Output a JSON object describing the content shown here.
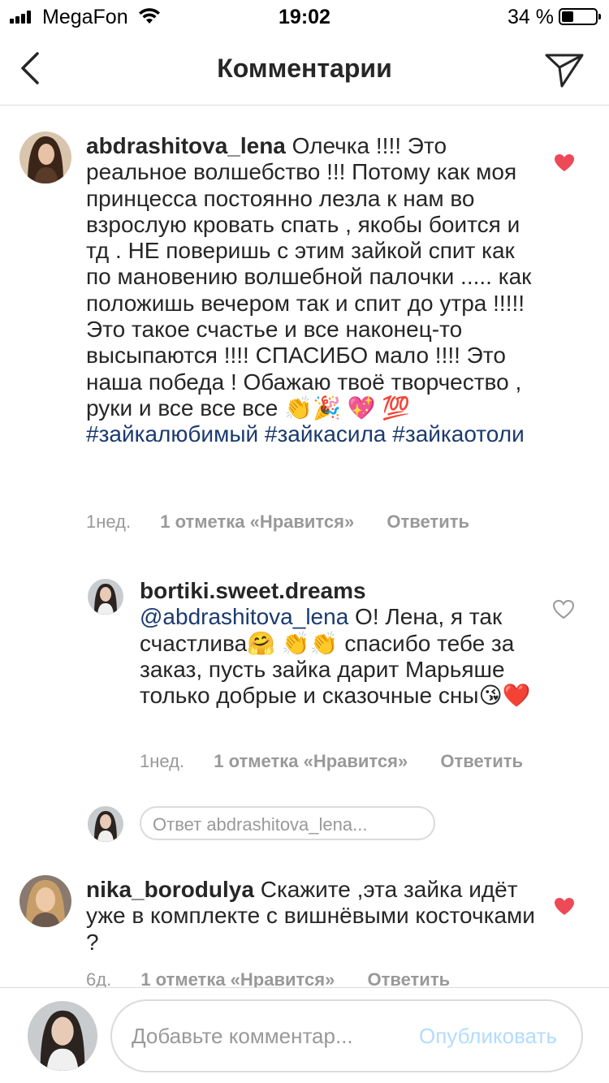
{
  "status_bar": {
    "carrier": "MegaFon",
    "time": "19:02",
    "battery": "34 %",
    "battery_level": 0.34
  },
  "header": {
    "title": "Комментарии"
  },
  "comments": [
    {
      "username": "abdrashitova_lena",
      "text": "Олечка !!!! Это реальное волшебство !!! Потому как моя принцесса постоянно лезла к нам во взрослую кровать спать , якобы боится и тд . НЕ поверишь с этим зайкой спит как по мановению волшебной палочки ..... как положишь вечером так и спит до утра !!!!! Это такое счастье и все наконец-то высыпаются !!!! СПАСИБО мало !!!! Это наша победа ! Обажаю твоё творчество , руки и все все все 👏🎉",
      "emoji_line": "💖 💯",
      "hashtags": [
        "#зайкалюбимый",
        "#зайкасила",
        "#зайкаотоли"
      ],
      "time": "1нед.",
      "likes": "1 отметка «Нравится»",
      "reply": "Ответить",
      "liked": true
    },
    {
      "username": "bortiki.sweet.dreams",
      "mention": "@abdrashitova_lena",
      "text": "О! Лена, я так счастлива🤗 👏👏 спасибо тебе за заказ,  пусть зайка дарит Марьяше только добрые и сказочные сны😘❤️",
      "time": "1нед.",
      "likes": "1 отметка «Нравится»",
      "reply": "Ответить",
      "liked": false
    },
    {
      "username": "nika_borodulya",
      "text": "Скажите ,эта зайка идёт уже в комплекте с вишнёвыми косточками ?",
      "time": "6д.",
      "likes": "1 отметка «Нравится»",
      "reply": "Ответить",
      "liked": true
    }
  ],
  "reply_input": {
    "placeholder": "Ответ abdrashitova_lena..."
  },
  "composer": {
    "placeholder": "Добавьте комментар...",
    "post_label": "Опубликовать"
  },
  "colors": {
    "heart_liked": "#ed4956",
    "hashtag": "#1b3a6f",
    "post_disabled": "#b3dbff"
  }
}
